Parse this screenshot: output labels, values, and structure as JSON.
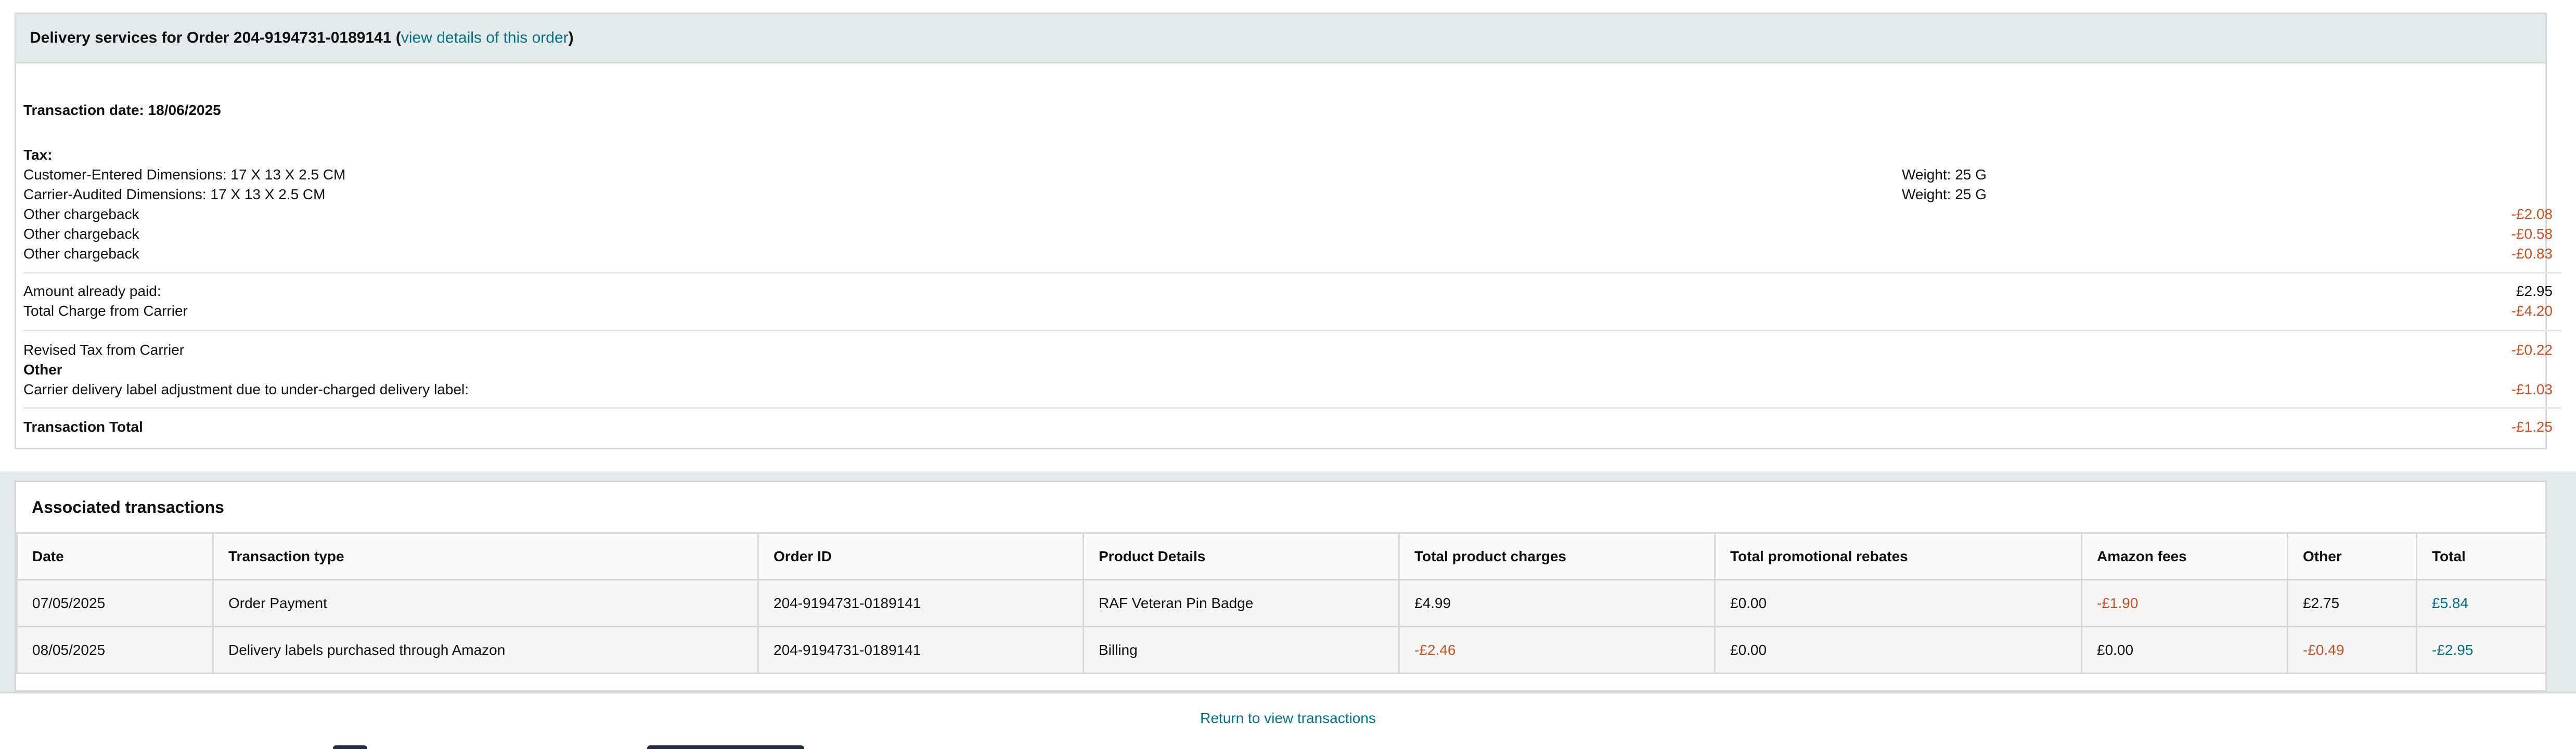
{
  "header": {
    "title_prefix": "Delivery services for Order 204-9194731-0189141 (",
    "link_label": "view details of this order",
    "title_suffix": ")"
  },
  "details": {
    "transaction_date": "Transaction date: 18/06/2025",
    "tax_label": "Tax:",
    "customer_dimensions": "Customer-Entered Dimensions: 17 X 13 X 2.5 CM",
    "customer_weight": "Weight: 25 G",
    "carrier_dimensions": "Carrier-Audited Dimensions: 17 X 13 X 2.5 CM",
    "carrier_weight": "Weight: 25 G",
    "chargebacks": [
      {
        "label": "Other chargeback",
        "amount": "-£2.08"
      },
      {
        "label": "Other chargeback",
        "amount": "-£0.58"
      },
      {
        "label": "Other chargeback",
        "amount": "-£0.83"
      }
    ],
    "already_paid_label": "Amount already paid:",
    "already_paid_amount": "£2.95",
    "total_carrier_label": "Total Charge from Carrier",
    "total_carrier_amount": "-£4.20",
    "revised_tax_label": "Revised Tax from Carrier",
    "revised_tax_amount": "-£0.22",
    "other_label": "Other",
    "adjustment_label": "Carrier delivery label adjustment due to under-charged delivery label:",
    "adjustment_amount": "-£1.03",
    "total_label": "Transaction Total",
    "total_amount": "-£1.25"
  },
  "associated": {
    "title": "Associated transactions",
    "columns": [
      "Date",
      "Transaction type",
      "Order ID",
      "Product Details",
      "Total product charges",
      "Total promotional rebates",
      "Amazon fees",
      "Other",
      "Total"
    ],
    "rows": [
      [
        "07/05/2025",
        "Order Payment",
        "204-9194731-0189141",
        "RAF Veteran Pin Badge",
        "£4.99",
        "£0.00",
        "-£1.90",
        "£2.75",
        "£5.84"
      ],
      [
        "08/05/2025",
        "Delivery labels purchased through Amazon",
        "204-9194731-0189141",
        "Billing",
        "-£2.46",
        "£0.00",
        "£0.00",
        "-£0.49",
        "-£2.95"
      ]
    ]
  },
  "footer": {
    "return_link": "Return to view transactions"
  },
  "colors": {
    "negative": "#c7511f",
    "link": "#007185",
    "header_bg": "#e3eaeb"
  }
}
